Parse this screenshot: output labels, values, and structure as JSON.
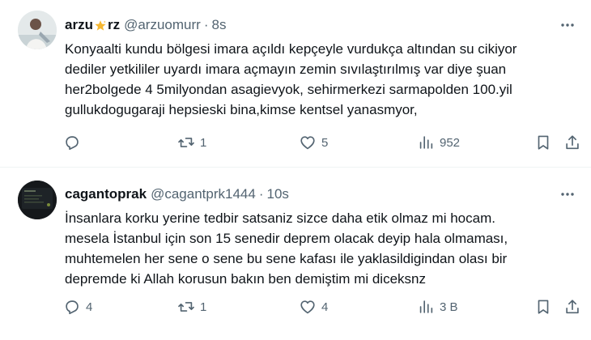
{
  "tweets": [
    {
      "display_name_pre": "arzu",
      "display_name_post": "rz",
      "handle": "@arzuomurr",
      "separator": "·",
      "time": "8s",
      "text_lines": [
        "Konyaalti kundu bölgesi imara açıldı kepçeyle vurdukça altından su cikiyor",
        "dediler yetkililer uyardı imara açmayın zemin sıvılaştırılmış var diye şuan",
        "her2bolgede 4 5milyondan asagievyok, sehirmerkezi sarmapolden 100.yil",
        "gullukdogugaraji hepsieski bina,kimse kentsel yanasmyor,"
      ],
      "reply_count": "",
      "retweet_count": "1",
      "like_count": "5",
      "view_count": "952"
    },
    {
      "display_name": "cagantoprak",
      "handle": "@cagantprk1444",
      "separator": "·",
      "time": "10s",
      "text_lines": [
        "İnsanlara korku yerine tedbir satsaniz sizce daha etik olmaz mi hocam.",
        "mesela İstanbul için son 15 senedir deprem olacak deyip hala olmaması,",
        "muhtemelen her sene o sene bu sene kafası ile yaklasildigindan olası bir",
        "depremde ki Allah korusun bakın ben demiştim mi diceksnz"
      ],
      "reply_count": "4",
      "retweet_count": "1",
      "like_count": "4",
      "view_count": "3 B"
    }
  ],
  "icons": {
    "more": "more-horizontal-icon",
    "reply": "reply-bubble-icon",
    "retweet": "retweet-icon",
    "like": "heart-icon",
    "views": "views-bar-chart-icon",
    "bookmark": "bookmark-icon",
    "share": "share-upload-icon",
    "name_emoji": "glowing-star-icon"
  },
  "colors": {
    "text": "#0f1419",
    "secondary": "#536471",
    "divider": "#eff3f4",
    "star": "#f5b731"
  }
}
